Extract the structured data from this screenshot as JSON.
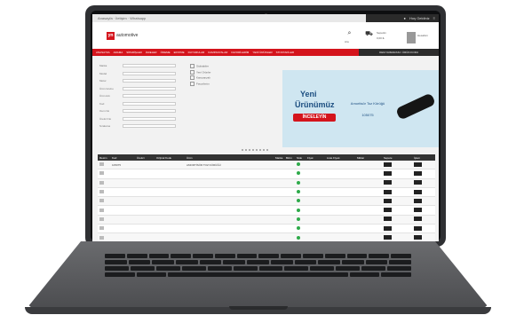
{
  "topbar": {
    "left_text": "Anasayfa · İletişim · Whatsapp",
    "user_text": "Hoş Geldiniz"
  },
  "header": {
    "logo_mark": "yn",
    "logo_text": "automotive",
    "search_label": "Ara",
    "cart_label": "Sepetim",
    "cart_value": "0,00 ₺",
    "account_label": "Hesabım"
  },
  "nav": {
    "items": [
      "ANASAYFA",
      "ARAMA",
      "SİPARİŞLER",
      "İADELER",
      "ÖDEME",
      "EKSTRE",
      "DUYURULAR",
      "KAMPANYALAR",
      "FAVORİLERİM",
      "YENİ ÜRÜNLER",
      "STOKTAKİLER"
    ],
    "right_label": "OEM NUMARASI / ÜRÜN KODU"
  },
  "filters": {
    "rows": [
      "Marka",
      "Model",
      "Motor",
      "Ürün Grubu",
      "Ürün Adı",
      "Kod",
      "Oem No",
      "Üretici No",
      "Sıralama"
    ],
    "checkboxes": [
      "Stoktakiler",
      "Yeni Ürünler",
      "Kampanyalı",
      "Favorilerim"
    ]
  },
  "promo": {
    "line1": "Yeni",
    "line2": "Ürünümüz",
    "cta": "İNCELEYİN",
    "desc": "Amortisör Toz Körüğü",
    "code": "105075"
  },
  "table": {
    "headers": [
      "Resim",
      "Kod",
      "Üretici",
      "Orijinal Kodu",
      "Ürün",
      "Marka",
      "Birim",
      "Stok",
      "Fiyat",
      "Liste Fiyatı",
      "Miktar",
      "Sepete",
      "İşlem"
    ],
    "rows": [
      [
        "",
        "105075",
        "",
        "",
        "AMORTİSÖR TOZ KÖRÜĞÜ",
        "",
        "",
        "",
        "",
        "",
        "",
        "",
        ""
      ],
      [
        "",
        "",
        "",
        "",
        "",
        "",
        "",
        "",
        "",
        "",
        "",
        "",
        ""
      ],
      [
        "",
        "",
        "",
        "",
        "",
        "",
        "",
        "",
        "",
        "",
        "",
        "",
        ""
      ],
      [
        "",
        "",
        "",
        "",
        "",
        "",
        "",
        "",
        "",
        "",
        "",
        "",
        ""
      ],
      [
        "",
        "",
        "",
        "",
        "",
        "",
        "",
        "",
        "",
        "",
        "",
        "",
        ""
      ],
      [
        "",
        "",
        "",
        "",
        "",
        "",
        "",
        "",
        "",
        "",
        "",
        "",
        ""
      ],
      [
        "",
        "",
        "",
        "",
        "",
        "",
        "",
        "",
        "",
        "",
        "",
        "",
        ""
      ],
      [
        "",
        "",
        "",
        "",
        "",
        "",
        "",
        "",
        "",
        "",
        "",
        "",
        ""
      ],
      [
        "",
        "",
        "",
        "",
        "",
        "",
        "",
        "",
        "",
        "",
        "",
        "",
        ""
      ],
      [
        "",
        "",
        "",
        "",
        "",
        "",
        "",
        "",
        "",
        "",
        "",
        "",
        ""
      ]
    ]
  },
  "colors": {
    "brand": "#d4141c",
    "dark": "#2c2c2c",
    "promo_bg": "#cfe6f1"
  }
}
